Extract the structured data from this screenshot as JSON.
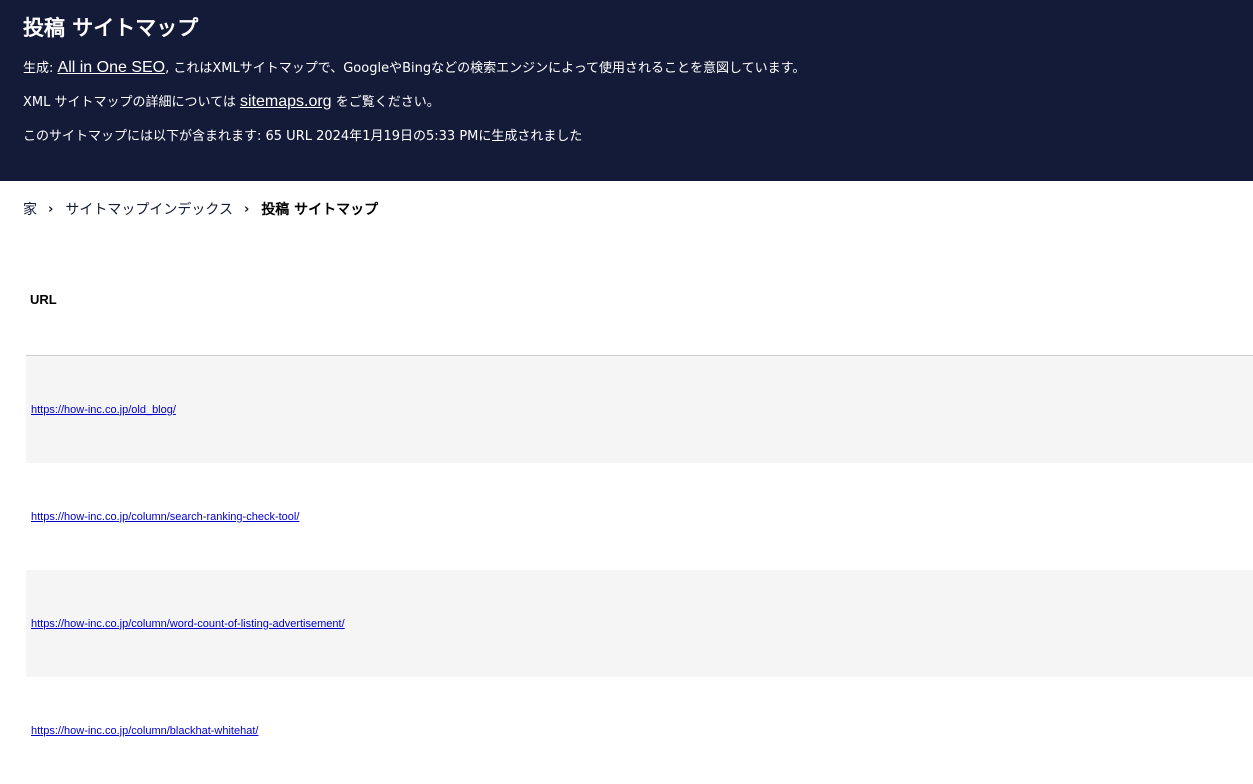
{
  "header": {
    "title": "投稿 サイトマップ",
    "line1_prefix": "生成: ",
    "line1_link": "All in One SEO",
    "line1_suffix": ", これはXMLサイトマップで、GoogleやBingなどの検索エンジンによって使用されることを意図しています。",
    "line2_prefix": "XML サイトマップの詳細については ",
    "line2_link": "sitemaps.org",
    "line2_suffix": " をご覧ください。",
    "line3": "このサイトマップには以下が含まれます: 65 URL 2024年1月19日の5:33 PMに生成されました"
  },
  "breadcrumb": {
    "home": "家",
    "index": "サイトマップインデックス",
    "current": "投稿 サイトマップ",
    "separator": "›"
  },
  "table": {
    "header": "URL",
    "rows": [
      "https://how-inc.co.jp/old_blog/",
      "https://how-inc.co.jp/column/search-ranking-check-tool/",
      "https://how-inc.co.jp/column/word-count-of-listing-advertisement/",
      "https://how-inc.co.jp/column/blackhat-whitehat/"
    ]
  }
}
